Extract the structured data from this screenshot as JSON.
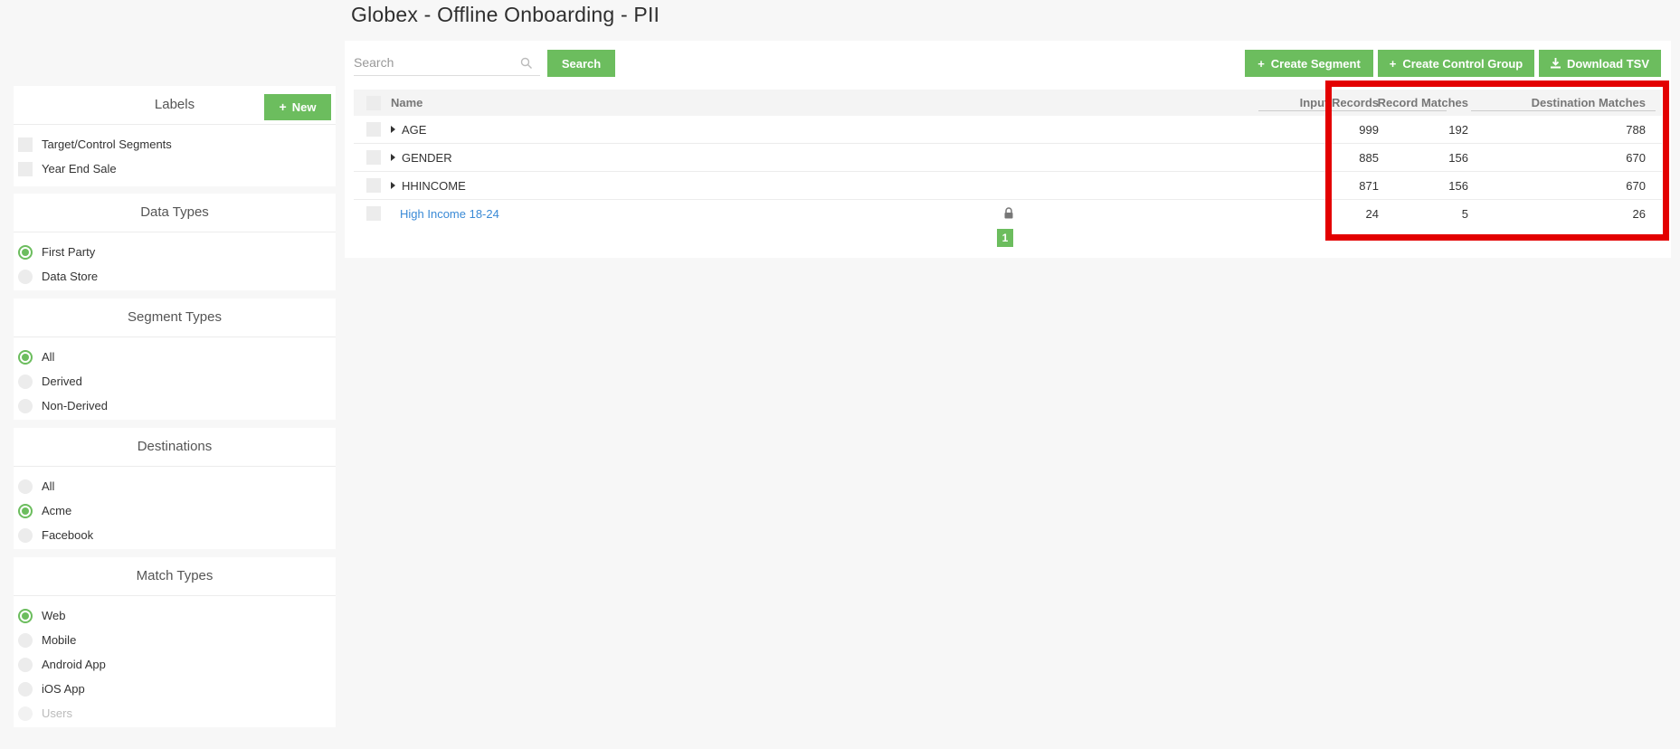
{
  "page": {
    "title": "Globex - Offline Onboarding - PII"
  },
  "toolbar": {
    "search_placeholder": "Search",
    "search_label": "Search",
    "create_segment_label": "Create Segment",
    "create_control_group_label": "Create Control Group",
    "download_label": "Download TSV",
    "accent_color": "#6cbd5e"
  },
  "sidebar": {
    "labels": {
      "title": "Labels",
      "new_label": "New",
      "items": [
        {
          "label": "Target/Control Segments",
          "checked": false
        },
        {
          "label": "Year End Sale",
          "checked": false
        }
      ]
    },
    "data_types": {
      "title": "Data Types",
      "items": [
        {
          "label": "First Party",
          "selected": true
        },
        {
          "label": "Data Store",
          "selected": false
        }
      ]
    },
    "segment_types": {
      "title": "Segment Types",
      "items": [
        {
          "label": "All",
          "selected": true
        },
        {
          "label": "Derived",
          "selected": false
        },
        {
          "label": "Non-Derived",
          "selected": false
        }
      ]
    },
    "destinations": {
      "title": "Destinations",
      "items": [
        {
          "label": "All",
          "selected": false
        },
        {
          "label": "Acme",
          "selected": true
        },
        {
          "label": "Facebook",
          "selected": false
        }
      ]
    },
    "match_types": {
      "title": "Match Types",
      "items": [
        {
          "label": "Web",
          "selected": true
        },
        {
          "label": "Mobile",
          "selected": false
        },
        {
          "label": "Android App",
          "selected": false
        },
        {
          "label": "iOS App",
          "selected": false
        },
        {
          "label": "Users",
          "selected": false,
          "disabled": true
        }
      ]
    }
  },
  "table": {
    "columns": {
      "name": "Name",
      "input_records": "Input Records",
      "record_matches": "Record Matches",
      "destination_matches": "Destination Matches"
    },
    "rows": [
      {
        "name": "AGE",
        "expandable": true,
        "input_records": "999",
        "record_matches": "192",
        "destination_matches": "788"
      },
      {
        "name": "GENDER",
        "expandable": true,
        "input_records": "885",
        "record_matches": "156",
        "destination_matches": "670"
      },
      {
        "name": "HHINCOME",
        "expandable": true,
        "input_records": "871",
        "record_matches": "156",
        "destination_matches": "670"
      },
      {
        "name": "High Income 18-24",
        "expandable": false,
        "link": true,
        "locked": true,
        "input_records": "24",
        "record_matches": "5",
        "destination_matches": "26"
      }
    ]
  },
  "pagination": {
    "current_page": "1"
  },
  "annotation": {
    "highlight_color": "#e30000"
  }
}
